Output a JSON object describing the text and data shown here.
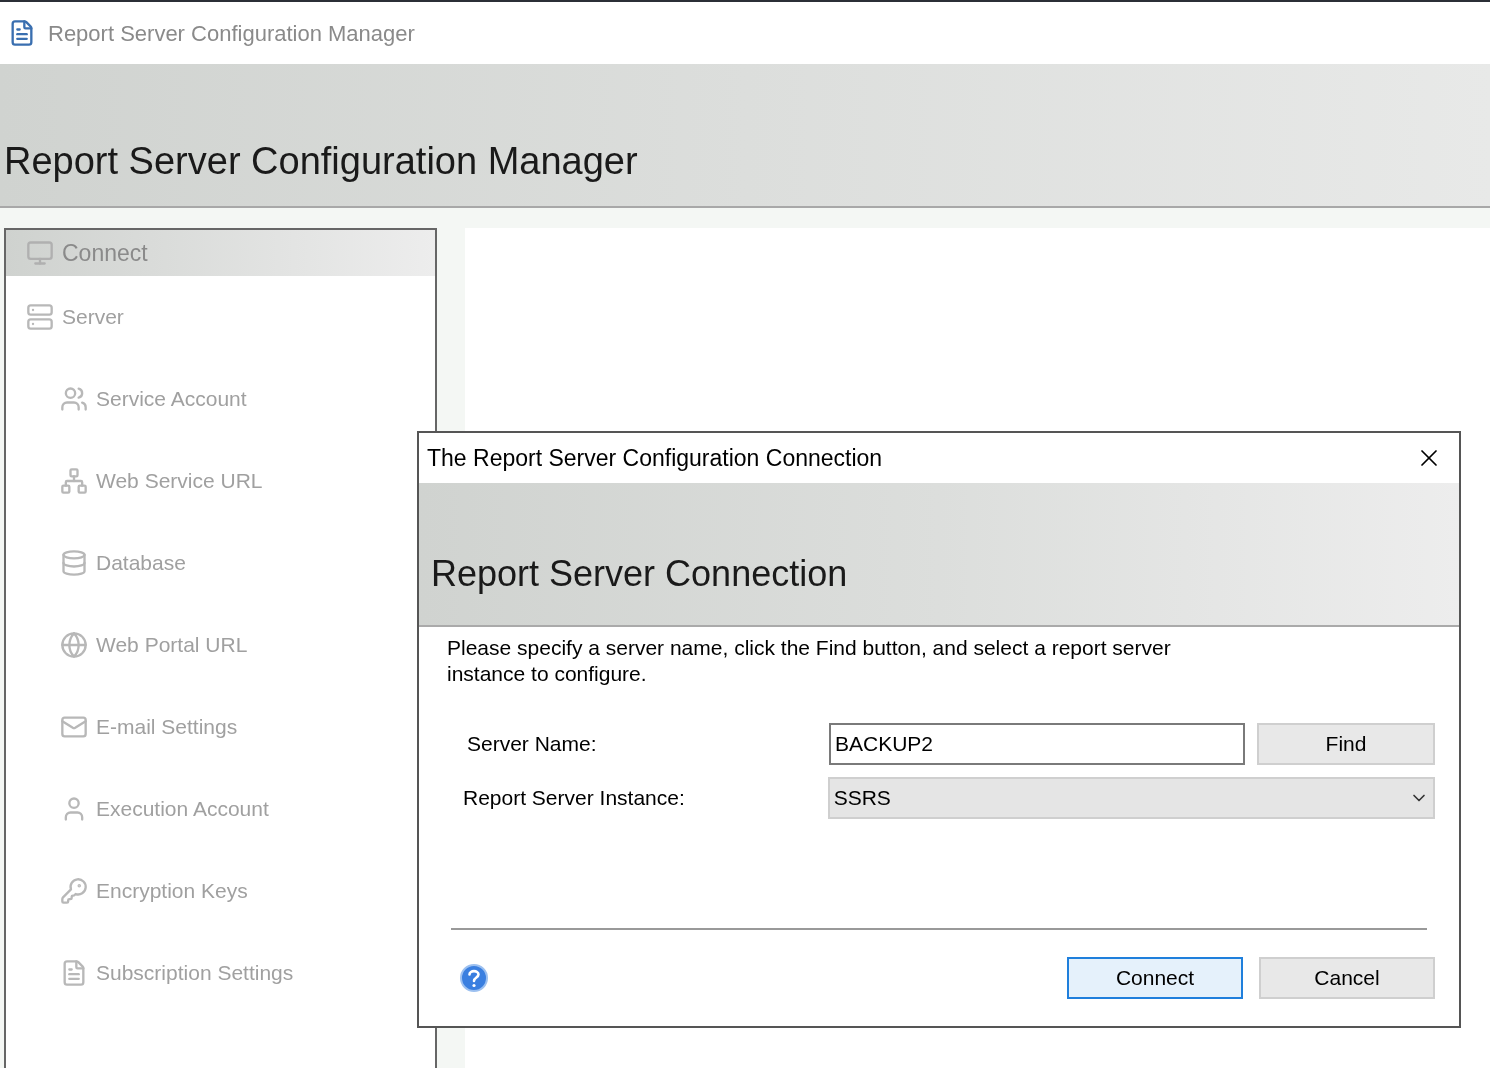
{
  "window": {
    "title": "Report Server Configuration Manager"
  },
  "header": {
    "title": "Report Server Configuration Manager"
  },
  "sidebar": {
    "connect": {
      "label": "Connect",
      "disabled": true
    },
    "items": [
      {
        "label": "Server",
        "kind": "server",
        "disabled": true,
        "children": [
          {
            "label": "Service Account",
            "kind": "account",
            "disabled": true
          },
          {
            "label": "Web Service URL",
            "kind": "webservice",
            "disabled": true
          },
          {
            "label": "Database",
            "kind": "database",
            "disabled": true
          },
          {
            "label": "Web Portal URL",
            "kind": "globe",
            "disabled": true
          },
          {
            "label": "E-mail Settings",
            "kind": "mail",
            "disabled": true
          },
          {
            "label": "Execution Account",
            "kind": "person",
            "disabled": true
          },
          {
            "label": "Encryption Keys",
            "kind": "keys",
            "disabled": true
          },
          {
            "label": "Subscription Settings",
            "kind": "subscription",
            "disabled": true
          }
        ]
      }
    ]
  },
  "dialog": {
    "title": "The Report Server Configuration Connection",
    "heading": "Report Server Connection",
    "description": "Please specify a server name, click the Find button, and select a report server instance to configure.",
    "server_name": {
      "label": "Server Name:",
      "value": "BACKUP2"
    },
    "find_button": "Find",
    "instance": {
      "label": "Report Server Instance:",
      "value": "SSRS"
    },
    "buttons": [
      {
        "label": "Connect",
        "selected": true
      },
      {
        "label": "Cancel",
        "selected": false
      }
    ]
  }
}
